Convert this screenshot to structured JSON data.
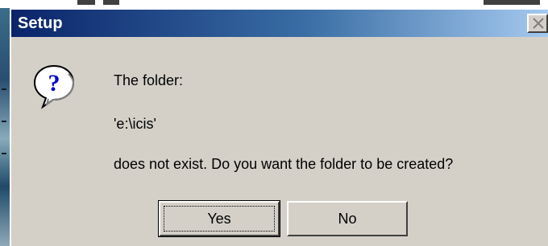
{
  "dialog": {
    "title": "Setup",
    "icon": "question-icon",
    "message_line1": "The folder:",
    "folder_path": "'e:\\icis'",
    "message_line3": "does not exist.  Do you want the folder to be created?",
    "buttons": {
      "yes": "Yes",
      "no": "No"
    },
    "close_icon": "close-icon"
  },
  "colors": {
    "titlebar_start": "#0a246a",
    "titlebar_end": "#a6caf0",
    "face": "#d4d0c8",
    "icon_blue": "#0000cc"
  }
}
